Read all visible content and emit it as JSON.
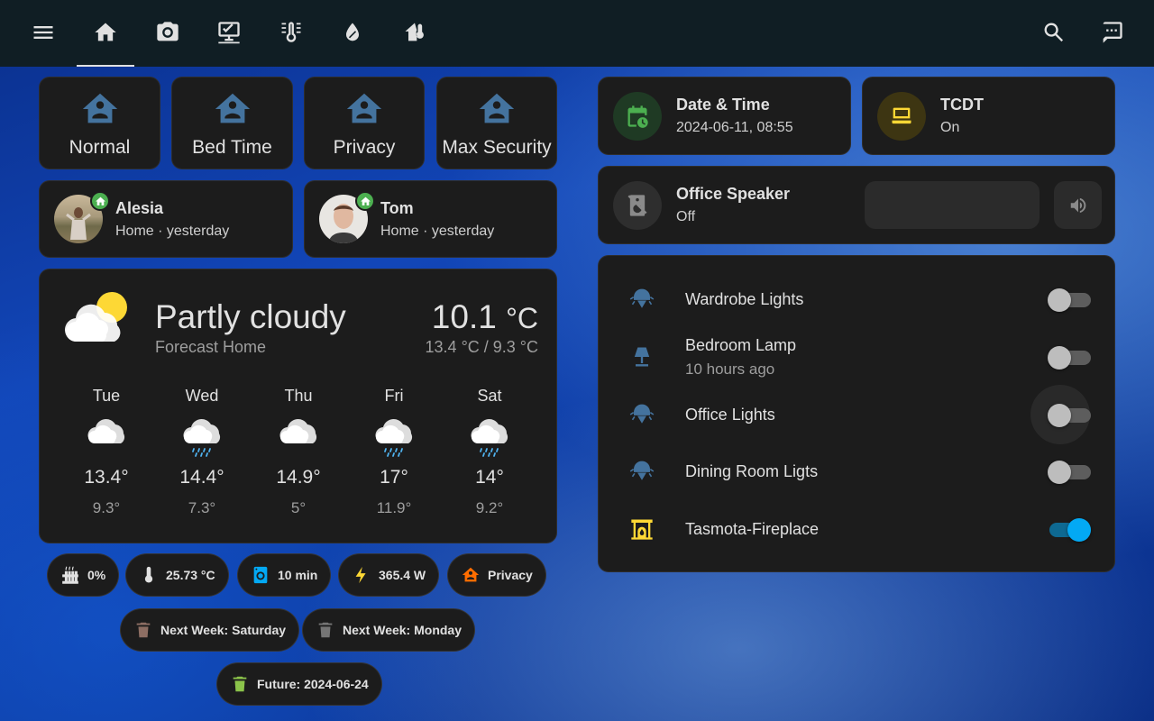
{
  "topbar": {
    "icons": [
      "menu-icon",
      "home-icon",
      "camera-icon",
      "monitor-check-icon",
      "thermometer-lines-icon",
      "water-off-icon",
      "home-thermometer-icon"
    ],
    "right_icons": [
      "search-icon",
      "message-icon"
    ]
  },
  "modes": [
    {
      "label": "Normal",
      "icon": "home-account-icon"
    },
    {
      "label": "Bed Time",
      "icon": "home-account-icon"
    },
    {
      "label": "Privacy",
      "icon": "home-account-icon"
    },
    {
      "label": "Max Security",
      "icon": "home-account-icon"
    }
  ],
  "people": [
    {
      "name": "Alesia",
      "status": "Home · yesterday"
    },
    {
      "name": "Tom",
      "status": "Home · yesterday"
    }
  ],
  "weather": {
    "condition": "Partly cloudy",
    "source": "Forecast Home",
    "temp": "10.1",
    "unit": "°C",
    "range": "13.4 °C / 9.3 °C",
    "forecast": [
      {
        "day": "Tue",
        "hi": "13.4°",
        "lo": "9.3°",
        "icon": "cloudy-icon"
      },
      {
        "day": "Wed",
        "hi": "14.4°",
        "lo": "7.3°",
        "icon": "rainy-icon"
      },
      {
        "day": "Thu",
        "hi": "14.9°",
        "lo": "5°",
        "icon": "cloudy-icon"
      },
      {
        "day": "Fri",
        "hi": "17°",
        "lo": "11.9°",
        "icon": "rainy-icon"
      },
      {
        "day": "Sat",
        "hi": "14°",
        "lo": "9.2°",
        "icon": "rainy-icon"
      }
    ]
  },
  "chips": {
    "heater": "0%",
    "temperature": "25.73 °C",
    "washer": "10 min",
    "power": "365.4 W",
    "mode": "Privacy",
    "bin1": "Next Week: Saturday",
    "bin2": "Next Week: Monday",
    "bin3": "Future: 2024-06-24"
  },
  "tiles": {
    "datetime": {
      "title": "Date & Time",
      "value": "2024-06-11, 08:55"
    },
    "tcdt": {
      "title": "TCDT",
      "value": "On"
    },
    "speaker": {
      "title": "Office Speaker",
      "value": "Off"
    }
  },
  "lights": [
    {
      "name": "Wardrobe Lights",
      "sub": "",
      "on": false,
      "icon": "ceiling-light-icon"
    },
    {
      "name": "Bedroom Lamp",
      "sub": "10 hours ago",
      "on": false,
      "icon": "lamp-icon"
    },
    {
      "name": "Office Lights",
      "sub": "",
      "on": false,
      "icon": "ceiling-light-icon"
    },
    {
      "name": "Dining Room Ligts",
      "sub": "",
      "on": false,
      "icon": "ceiling-light-icon"
    },
    {
      "name": "Tasmota-Fireplace",
      "sub": "",
      "on": true,
      "icon": "fireplace-icon"
    }
  ],
  "colors": {
    "accent": "#03a9f4",
    "mode_icon": "#44739e",
    "green": "#4caf50",
    "yellow": "#fdd835",
    "orange": "#ff6d00"
  }
}
